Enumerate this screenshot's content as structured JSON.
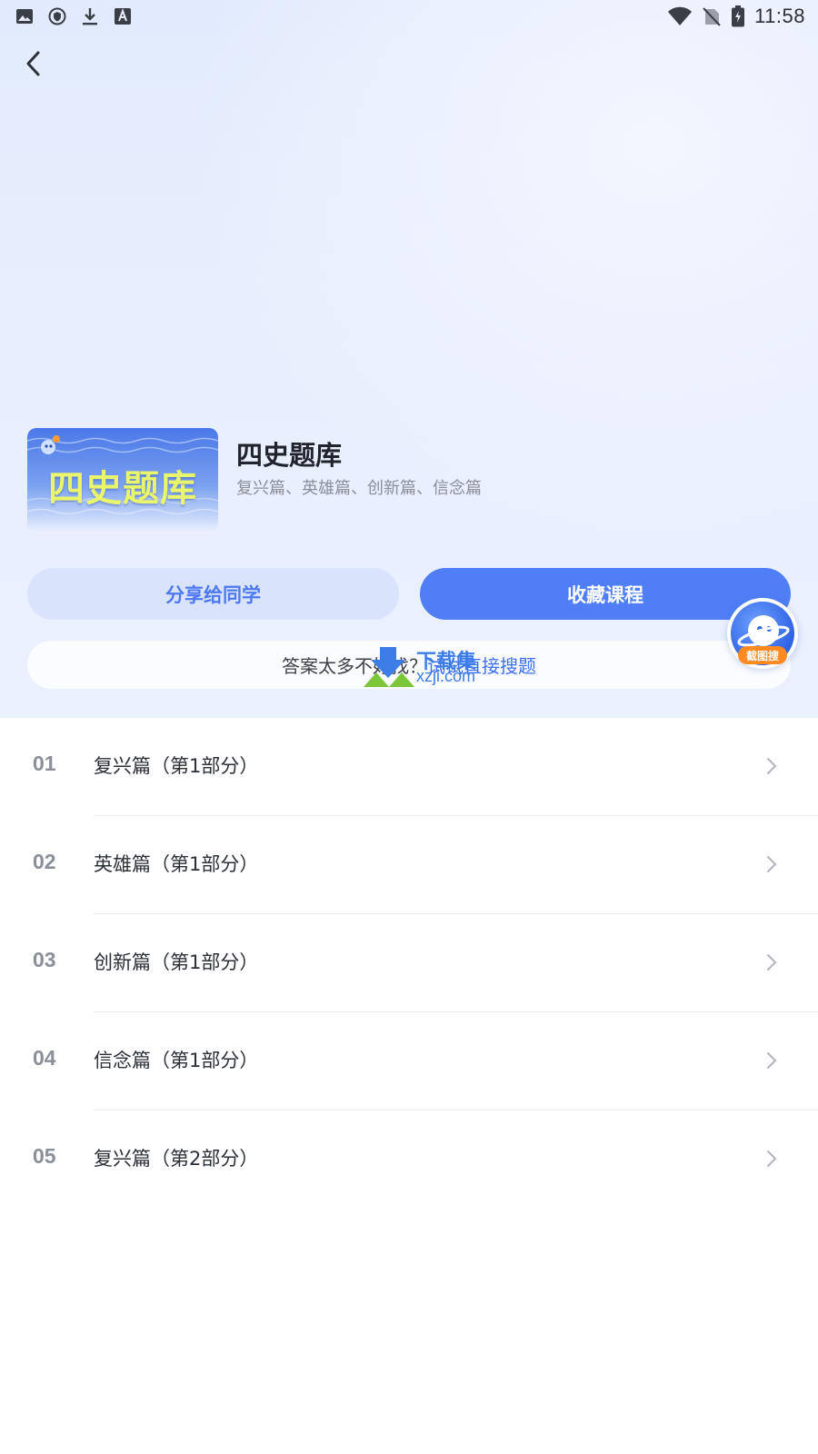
{
  "status_bar": {
    "time": "11:58",
    "left_icons": [
      "image-icon",
      "shield-icon",
      "download-icon",
      "text-a-icon"
    ],
    "right_icons": [
      "wifi-icon",
      "no-sim-icon",
      "battery-charging-icon"
    ]
  },
  "course": {
    "cover_text": "四史题库",
    "title": "四史题库",
    "subtitle": "复兴篇、英雄篇、创新篇、信念篇"
  },
  "actions": {
    "share_label": "分享给同学",
    "favorite_label": "收藏课程"
  },
  "promo": {
    "text": "答案太多不好找？",
    "link": "试试直接搜题"
  },
  "watermark": {
    "line1": "下载集",
    "line2": "xzji.com"
  },
  "float_button": {
    "badge": "截图搜"
  },
  "chapters": [
    {
      "num": "01",
      "title": "复兴篇（第1部分）"
    },
    {
      "num": "02",
      "title": "英雄篇（第1部分）"
    },
    {
      "num": "03",
      "title": "创新篇（第1部分）"
    },
    {
      "num": "04",
      "title": "信念篇（第1部分）"
    },
    {
      "num": "05",
      "title": "复兴篇（第2部分）"
    }
  ],
  "colors": {
    "accent": "#4f7ef6",
    "share_bg": "#d9e3fc",
    "badge": "#ff8a22",
    "cover_text": "#e9f56a"
  }
}
